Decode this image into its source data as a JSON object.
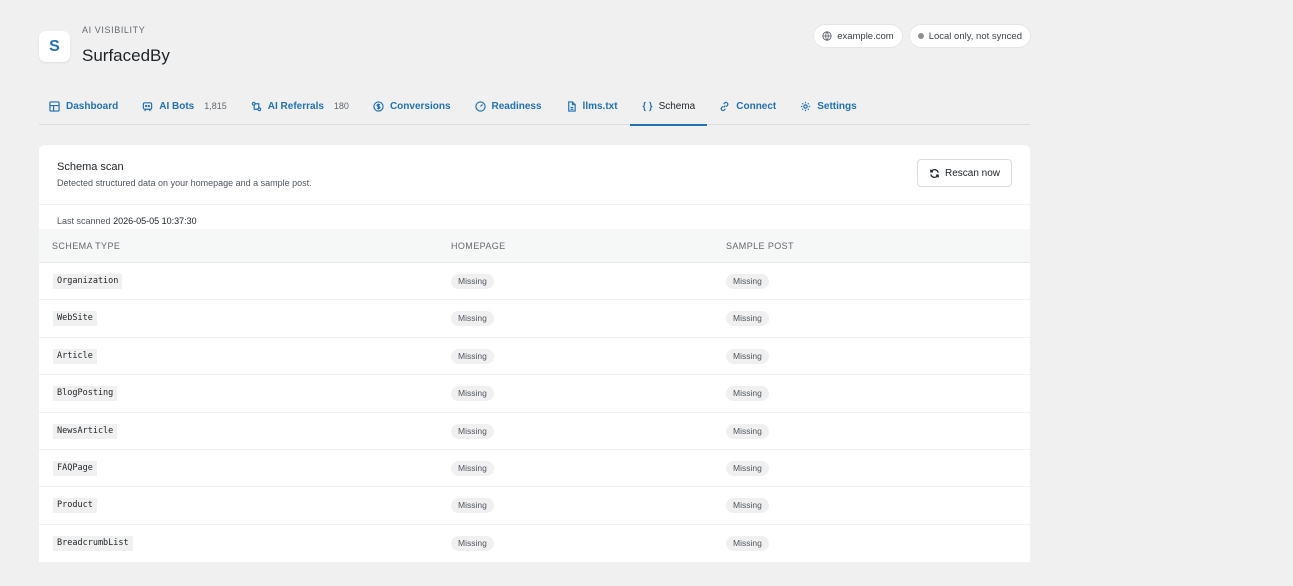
{
  "header": {
    "logo_letter": "S",
    "eyebrow": "AI VISIBILITY",
    "title": "SurfacedBy",
    "site_pill": "example.com",
    "sync_pill": "Local only, not synced"
  },
  "tabs": [
    {
      "label": "Dashboard",
      "icon": "dashboard-icon"
    },
    {
      "label": "AI Bots",
      "count": "1,815",
      "icon": "bot-icon"
    },
    {
      "label": "AI Referrals",
      "count": "180",
      "icon": "referrals-icon"
    },
    {
      "label": "Conversions",
      "icon": "dollar-icon"
    },
    {
      "label": "Readiness",
      "icon": "gauge-icon"
    },
    {
      "label": "llms.txt",
      "icon": "file-icon"
    },
    {
      "label": "Schema",
      "icon": "braces-icon",
      "active": true
    },
    {
      "label": "Connect",
      "icon": "link-icon"
    },
    {
      "label": "Settings",
      "icon": "gear-icon"
    }
  ],
  "card": {
    "title": "Schema scan",
    "subtitle": "Detected structured data on your homepage and a sample post.",
    "rescan_label": "Rescan now",
    "last_scanned_label": "Last scanned",
    "last_scanned_value": "2026-05-05 10:37:30"
  },
  "table": {
    "columns": [
      "SCHEMA TYPE",
      "HOMEPAGE",
      "SAMPLE POST"
    ],
    "rows": [
      {
        "type": "Organization",
        "homepage": "Missing",
        "sample": "Missing"
      },
      {
        "type": "WebSite",
        "homepage": "Missing",
        "sample": "Missing"
      },
      {
        "type": "Article",
        "homepage": "Missing",
        "sample": "Missing"
      },
      {
        "type": "BlogPosting",
        "homepage": "Missing",
        "sample": "Missing"
      },
      {
        "type": "NewsArticle",
        "homepage": "Missing",
        "sample": "Missing"
      },
      {
        "type": "FAQPage",
        "homepage": "Missing",
        "sample": "Missing"
      },
      {
        "type": "Product",
        "homepage": "Missing",
        "sample": "Missing"
      },
      {
        "type": "BreadcrumbList",
        "homepage": "Missing",
        "sample": "Missing"
      }
    ]
  },
  "colors": {
    "accent": "#2271b1",
    "background": "#f0f0f1"
  }
}
